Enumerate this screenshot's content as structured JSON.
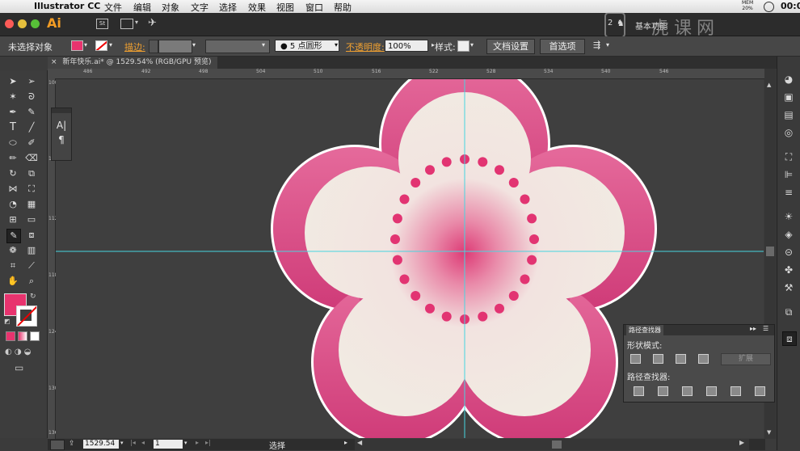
{
  "menubar": {
    "app_name": "Illustrator CC",
    "items": [
      "文件",
      "编辑",
      "对象",
      "文字",
      "选择",
      "效果",
      "视图",
      "窗口",
      "帮助"
    ],
    "mem_label": "MEM",
    "mem_value": "20%",
    "clock": "00:0"
  },
  "appbar": {
    "logo": "Ai",
    "br_label": "St",
    "badge": "2",
    "workspace": "基本功能",
    "watermark": "虎课网"
  },
  "control": {
    "selection_label": "未选择对象",
    "stroke_label": "描边:",
    "brush_label": "5 点圆形",
    "opacity_label": "不透明度:",
    "opacity_value": "100%",
    "style_label": "样式:",
    "doc_setup": "文档设置",
    "preferences": "首选项",
    "fill_color": "#e8336e"
  },
  "document": {
    "tab_title": "新年快乐.ai* @ 1529.54% (RGB/GPU 预览)"
  },
  "ruler": {
    "h_ticks": [
      "486",
      "492",
      "498",
      "504",
      "510",
      "516",
      "522",
      "528",
      "534",
      "540",
      "546"
    ],
    "v_ticks": [
      "100",
      "106",
      "112",
      "118",
      "124",
      "130",
      "136"
    ]
  },
  "text_panel": {
    "char_icon": "A|",
    "para_icon": "¶"
  },
  "pathfinder": {
    "title": "路径查找器",
    "shape_modes": "形状模式:",
    "pathfinders": "路径查找器:",
    "expand": "扩展"
  },
  "status": {
    "zoom": "1529.54",
    "artboard": "1",
    "mode": "选择"
  },
  "colors": {
    "accent": "#e8336e",
    "guide": "#47d5e0",
    "petal_outer": "#d94a85",
    "petal_inner": "#f2ede4"
  },
  "icons": [
    "apple-icon",
    "selection-tool-icon",
    "direct-selection-icon",
    "magic-wand-icon",
    "lasso-icon",
    "pen-icon",
    "type-icon",
    "line-icon",
    "ellipse-icon",
    "brush-icon",
    "eraser-icon",
    "rotate-icon",
    "scale-icon",
    "eyedropper-icon",
    "hand-icon",
    "zoom-icon",
    "color-icon",
    "layers-icon",
    "swatches-icon"
  ]
}
